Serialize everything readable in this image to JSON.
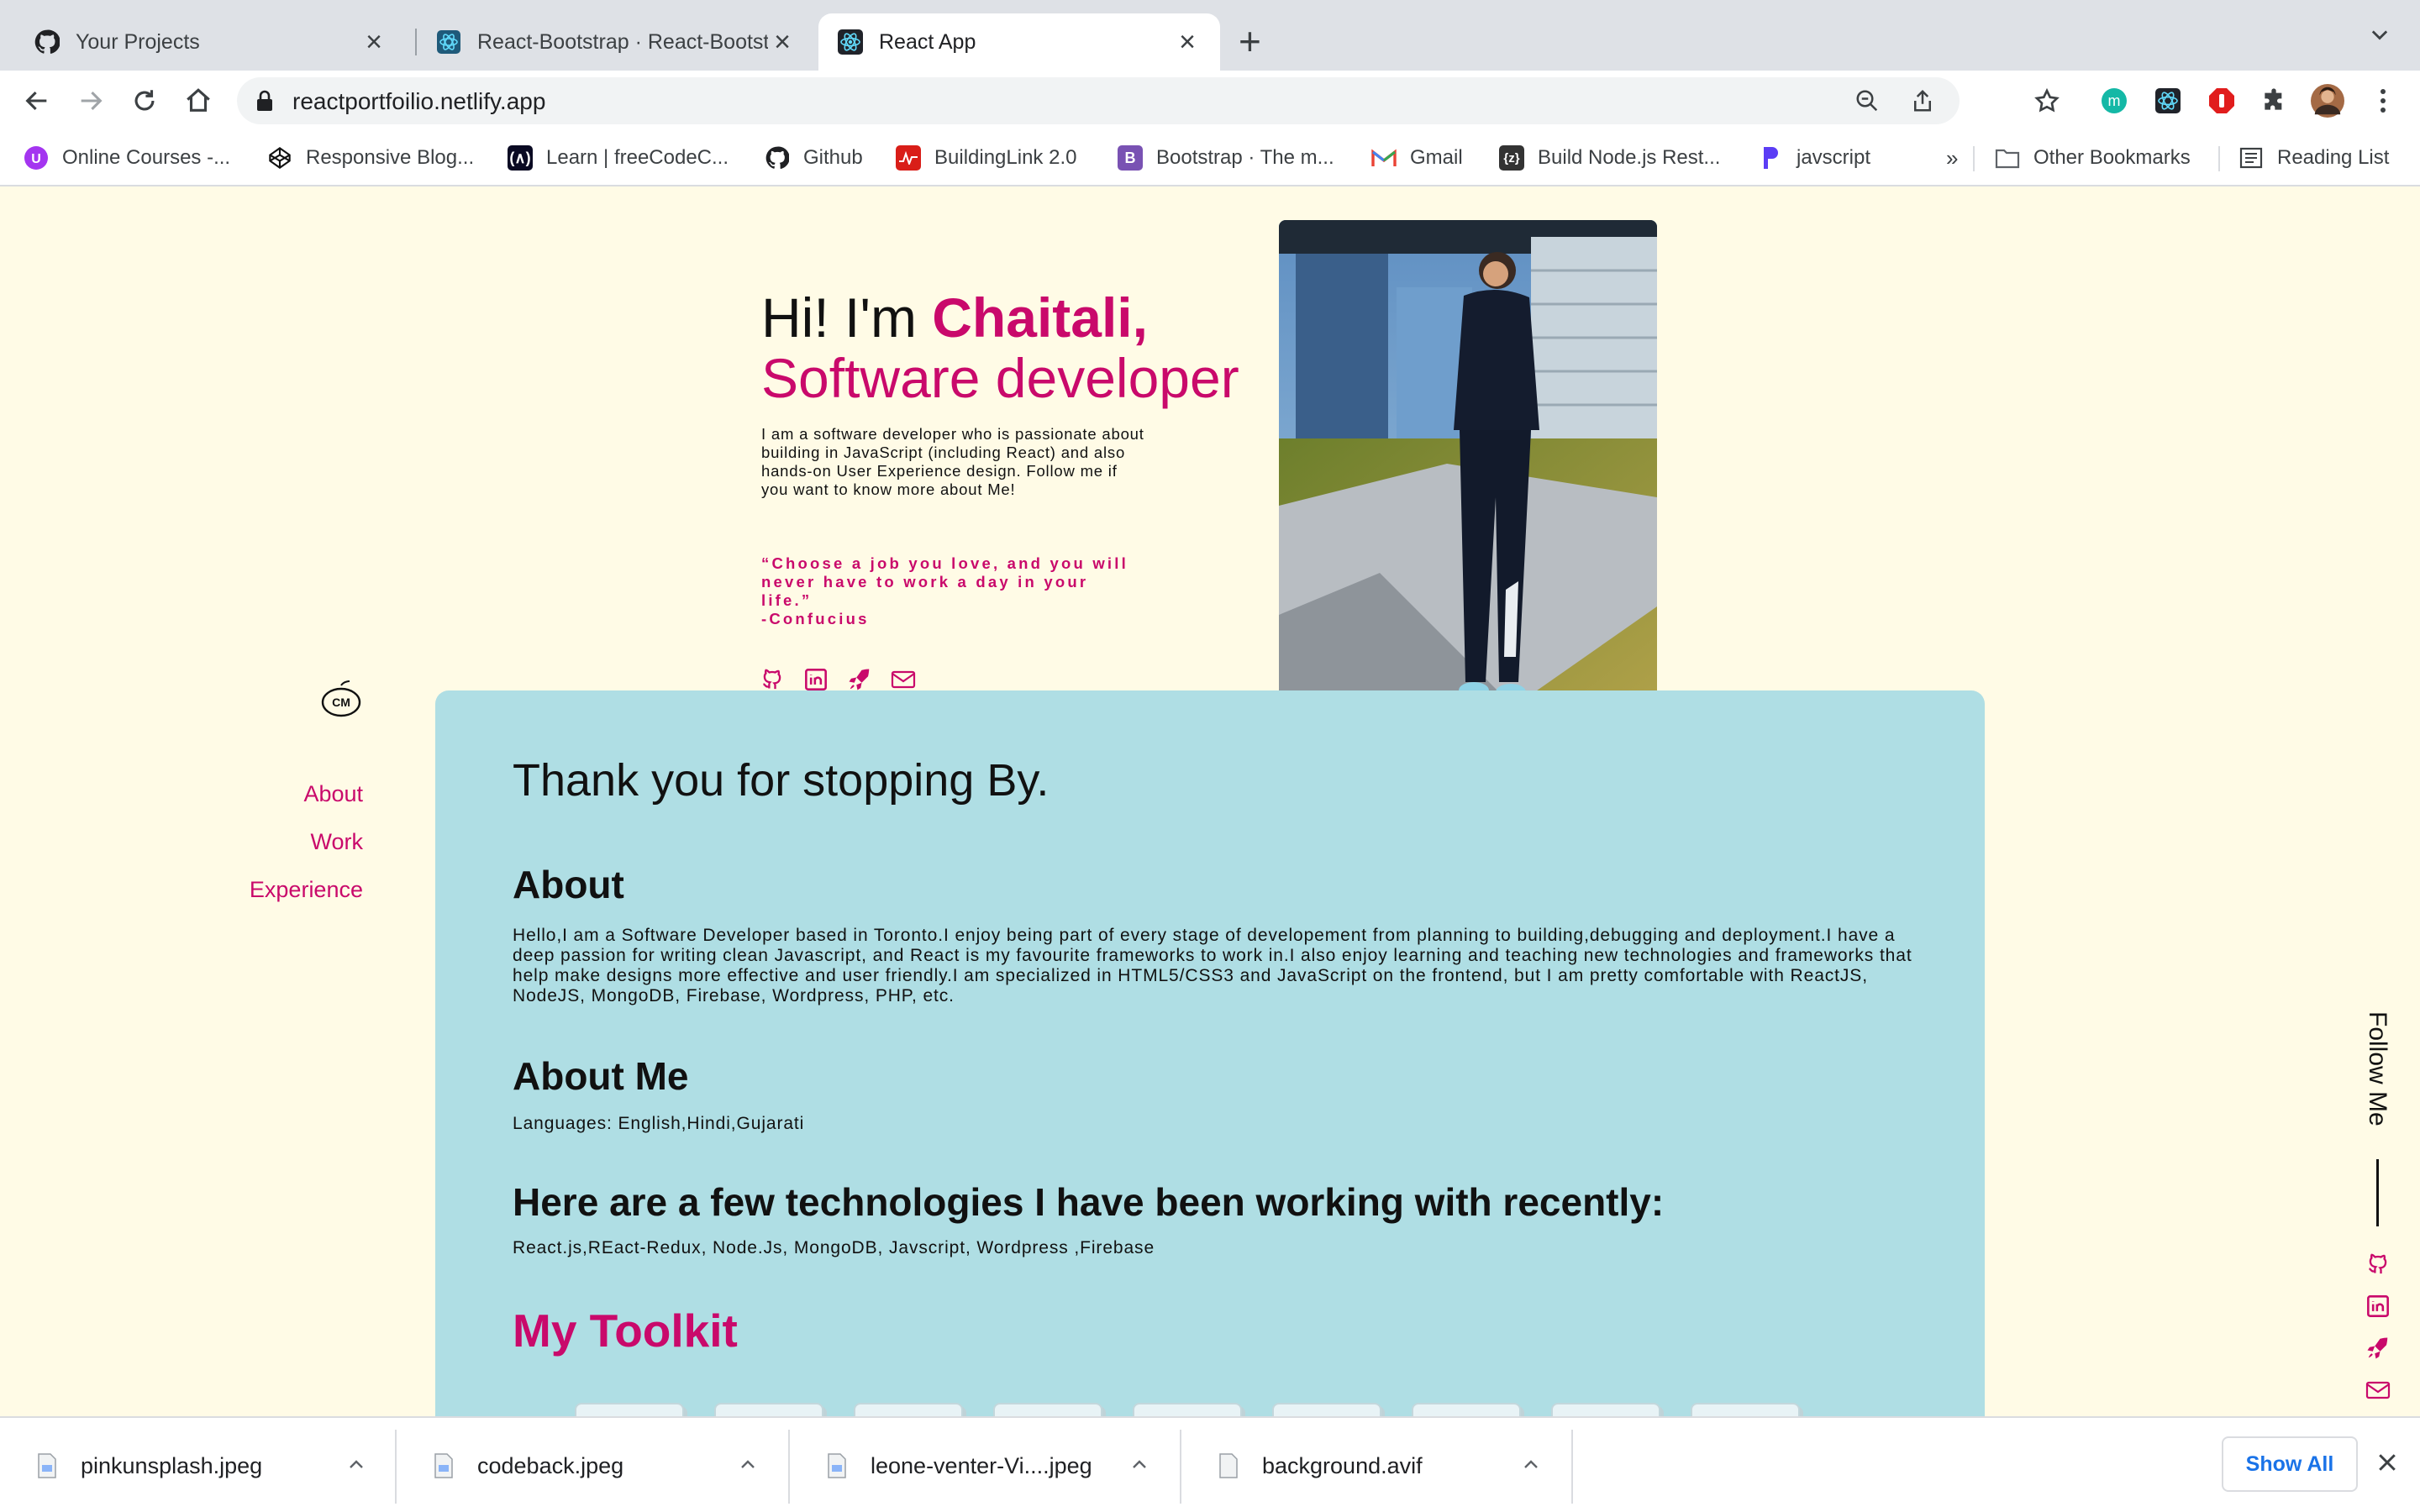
{
  "browser": {
    "tabs": [
      {
        "title": "Your Projects",
        "icon": "github-icon",
        "active": false
      },
      {
        "title": "React-Bootstrap · React-Bootstrap",
        "icon": "react-bootstrap-icon",
        "active": false
      },
      {
        "title": "React App",
        "icon": "react-icon",
        "active": true
      }
    ],
    "url": "reactportfoilio.netlify.app",
    "bookmarks": [
      {
        "label": "Online Courses -...",
        "icon": "udemy-icon"
      },
      {
        "label": "Responsive Blog...",
        "icon": "codepen-icon"
      },
      {
        "label": "Learn | freeCodeC...",
        "icon": "freecodecamp-icon"
      },
      {
        "label": "Github",
        "icon": "github-icon"
      },
      {
        "label": "BuildingLink 2.0",
        "icon": "buildinglink-icon"
      },
      {
        "label": "Bootstrap · The m...",
        "icon": "bootstrap-icon"
      },
      {
        "label": "Gmail",
        "icon": "gmail-icon"
      },
      {
        "label": "Build Node.js Rest...",
        "icon": "code-icon"
      },
      {
        "label": "javscript",
        "icon": "p-icon"
      }
    ],
    "bookmarks_overflow": "»",
    "other_bookmarks": "Other Bookmarks",
    "reading_list": "Reading List"
  },
  "hero": {
    "greeting": "Hi! I'm ",
    "name": "Chaitali,",
    "role": "Software developer",
    "description": "I am a software developer who is passionate about building in JavaScript (including React) and also hands-on User Experience design. Follow me if you want to know more about Me!",
    "quote": "“Choose a job you love, and you will never have to work a day in your life.”",
    "quote_author": "-Confucius"
  },
  "sidebar": {
    "links": [
      "About",
      "Work",
      "Experience"
    ]
  },
  "card": {
    "thanks": "Thank you for stopping By.",
    "about_heading": "About",
    "about_text": "Hello,I am a Software Developer based in Toronto.I enjoy being part of every stage of developement from planning to building,debugging and deployment.I have a deep passion for writing clean Javascript, and React is my favourite frameworks to work in.I also enjoy learning and teaching new technologies and frameworks that help make designs more effective and user friendly.I am specialized in HTML5/CSS3 and JavaScript on the frontend, but I am pretty comfortable with ReactJS, NodeJS, MongoDB, Firebase, Wordpress, PHP, etc.",
    "aboutme_heading": "About Me",
    "languages": "Languages: English,Hindi,Gujarati",
    "tech_heading": "Here are a few technologies I have been working with recently:",
    "tech_list": "React.js,REact-Redux, Node.Js, MongoDB, Javscript, Wordpress ,Firebase",
    "toolkit_heading": "My Toolkit"
  },
  "follow": {
    "label": "Follow Me"
  },
  "downloads": {
    "files": [
      "pinkunsplash.jpeg",
      "codeback.jpeg",
      "leone-venter-Vi....jpeg",
      "background.avif"
    ],
    "show_all": "Show All"
  },
  "colors": {
    "accent": "#c9096b",
    "page_bg": "#fffbe6",
    "card_bg": "#afdee4"
  }
}
